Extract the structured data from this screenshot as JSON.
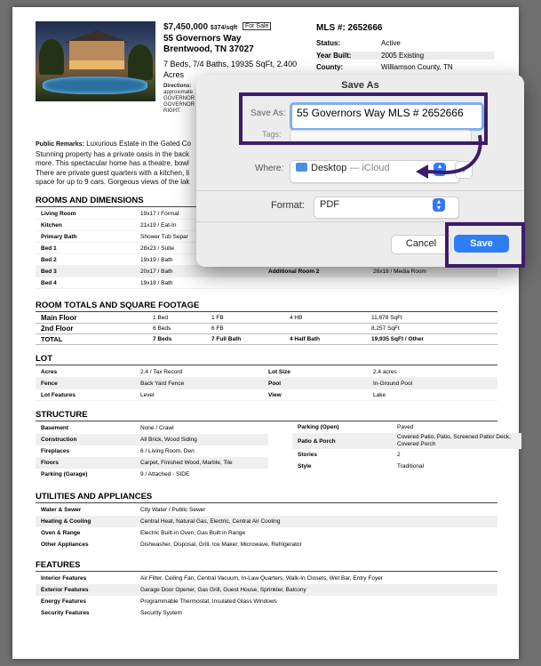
{
  "listing": {
    "price": "$7,450,000",
    "price_per_sqft": "$374/sqft",
    "status_tag": "For Sale",
    "address_line1": "55 Governors Way",
    "address_line2": "Brentwood, TN 37027",
    "beds_baths": "7 Beds, 7/4 Baths, 19935 SqFt, 2.400 Acres",
    "directions_label": "Directions:",
    "directions_text": "approximate\nGOVERNOR\nGOVERNOR\nRIGHT.",
    "mls_label": "MLS #: 2652666",
    "facts": [
      {
        "k": "Status:",
        "v": "Active"
      },
      {
        "k": "Year Built:",
        "v": "2005 Existing"
      },
      {
        "k": "County:",
        "v": "Williamson County, TN"
      }
    ],
    "remarks_label": "Public Remarks:",
    "remarks_text": "Luxurious Estate in the Gated Co\nStunning property has a private oasis in the back\nmore. This spectacular home has a theatre, bowl\nThere are private guest quarters with a kitchen, li\nspace for up to 9 cars. Gorgeous views of the lak"
  },
  "rooms": {
    "title": "ROOMS AND DIMENSIONS",
    "rows": [
      {
        "c1": "Living Room",
        "c2": "19x17 / Formal",
        "c3": "",
        "c4": ""
      },
      {
        "c1": "Kitchen",
        "c2": "21x19 / Eat-In",
        "c3": "",
        "c4": ""
      },
      {
        "c1": "Primary Bath",
        "c2": "Shower Tub Separ",
        "c3": "",
        "c4": ""
      },
      {
        "c1": "Bed 1",
        "c2": "28x23 / Suite",
        "c3": "",
        "c4": ""
      },
      {
        "c1": "Bed 2",
        "c2": "19x19 / Bath",
        "c3": "",
        "c4": ""
      },
      {
        "c1": "Bed 3",
        "c2": "20x17 / Bath",
        "c3": "Additional Room 2",
        "c4": "26x18 / Media Room"
      },
      {
        "c1": "Bed 4",
        "c2": "19x18 / Bath",
        "c3": "",
        "c4": ""
      }
    ]
  },
  "sqft": {
    "title": "ROOM TOTALS AND SQUARE FOOTAGE",
    "rows": [
      {
        "a": "Main Floor",
        "b": "1 Bed",
        "c": "1 FB",
        "d": "4 HB",
        "e": "11,678 SqFt"
      },
      {
        "a": "2nd Floor",
        "b": "6 Beds",
        "c": "6 FB",
        "d": "",
        "e": "8,257 SqFt"
      },
      {
        "a": "TOTAL",
        "b": "7 Beds",
        "c": "7 Full Bath",
        "d": "4 Half Bath",
        "e": "19,935 SqFt / Other"
      }
    ]
  },
  "lot": {
    "title": "LOT",
    "rows": [
      {
        "c1": "Acres",
        "c2": "2.4 / Tax Record",
        "c3": "Lot Size",
        "c4": "2.4 acres"
      },
      {
        "c1": "Fence",
        "c2": "Back Yard Fence",
        "c3": "Pool",
        "c4": "In-Ground Pool"
      },
      {
        "c1": "Lot Features",
        "c2": "Level",
        "c3": "View",
        "c4": "Lake"
      }
    ]
  },
  "structure": {
    "title": "STRUCTURE",
    "left": [
      {
        "k": "Basement",
        "v": "None / Crawl"
      },
      {
        "k": "Construction",
        "v": "All Brick, Wood Siding"
      },
      {
        "k": "Fireplaces",
        "v": "6 / Living Room, Den"
      },
      {
        "k": "Floors",
        "v": "Carpet, Finished Wood, Marble, Tile"
      },
      {
        "k": "Parking (Garage)",
        "v": "9 / Attached - SIDE"
      }
    ],
    "right": [
      {
        "k": "Parking (Open)",
        "v": "Paved"
      },
      {
        "k": "Patio & Porch",
        "v": "Covered Patio, Patio, Screened Patio/ Deck, Covered Porch"
      },
      {
        "k": "Stories",
        "v": "2"
      },
      {
        "k": "Style",
        "v": "Traditional"
      }
    ]
  },
  "utilities": {
    "title": "UTILITIES AND APPLIANCES",
    "rows": [
      {
        "k": "Water & Sewer",
        "v": "City Water / Public Sewer"
      },
      {
        "k": "Heating & Cooling",
        "v": "Central Heat, Natural Gas, Electric, Central Air Cooling"
      },
      {
        "k": "Oven & Range",
        "v": "Electric Built-in Oven, Gas Built in Range"
      },
      {
        "k": "Other Appliances",
        "v": "Dishwasher, Disposal, Grill, Ice Maker, Microwave, Refrigerator"
      }
    ]
  },
  "features": {
    "title": "FEATURES",
    "rows": [
      {
        "k": "Interior Features",
        "v": "Air Filter, Ceiling Fan, Central Vacuum, In-Law Quarters, Walk-In Closets, Wet Bar, Entry Foyer"
      },
      {
        "k": "Exterior Features",
        "v": "Garage Door Opener, Gas Grill, Guest House, Sprinkler, Balcony"
      },
      {
        "k": "Energy Features",
        "v": "Programmable Thermostat, Insulated Glass Windows"
      },
      {
        "k": "Security Features",
        "v": "Security System"
      }
    ]
  },
  "dialog": {
    "title": "Save As",
    "save_as_label": "Save As:",
    "filename": "55 Governors Way MLS # 2652666",
    "tags_label": "Tags:",
    "where_label": "Where:",
    "where_value": "Desktop",
    "where_suffix": "— iCloud",
    "format_label": "Format:",
    "format_value": "PDF",
    "cancel_label": "Cancel",
    "save_label": "Save",
    "accent_color": "#2f7df6",
    "highlight_color": "#3a1d6b"
  }
}
